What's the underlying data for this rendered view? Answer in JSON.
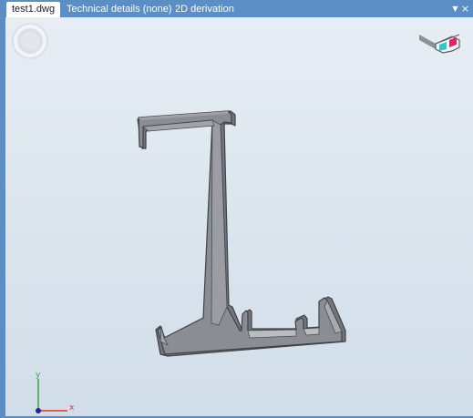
{
  "tabs": [
    {
      "label": "test1.dwg",
      "active": true
    },
    {
      "label": "Technical details (none)",
      "active": false
    },
    {
      "label": "2D derivation",
      "active": false
    }
  ],
  "tab_controls": {
    "menu_icon": "triangle-down-icon",
    "close_icon": "close-icon"
  },
  "viewport": {
    "background_top": "#e8edf4",
    "background_bottom": "#d1dde9",
    "model_color": "#8a8d93",
    "model_edge_color": "#3f4247",
    "model_highlight_color": "#b9bcc1",
    "icons": [
      "navigation-wheel-icon",
      "stereo-3d-glasses-icon",
      "axis-triad-icon"
    ]
  },
  "axis_triad": {
    "x_label": "x",
    "y_label": "y",
    "x_color": "#d23a2e",
    "y_color": "#3aa047",
    "z_color": "#1b2a8f"
  }
}
